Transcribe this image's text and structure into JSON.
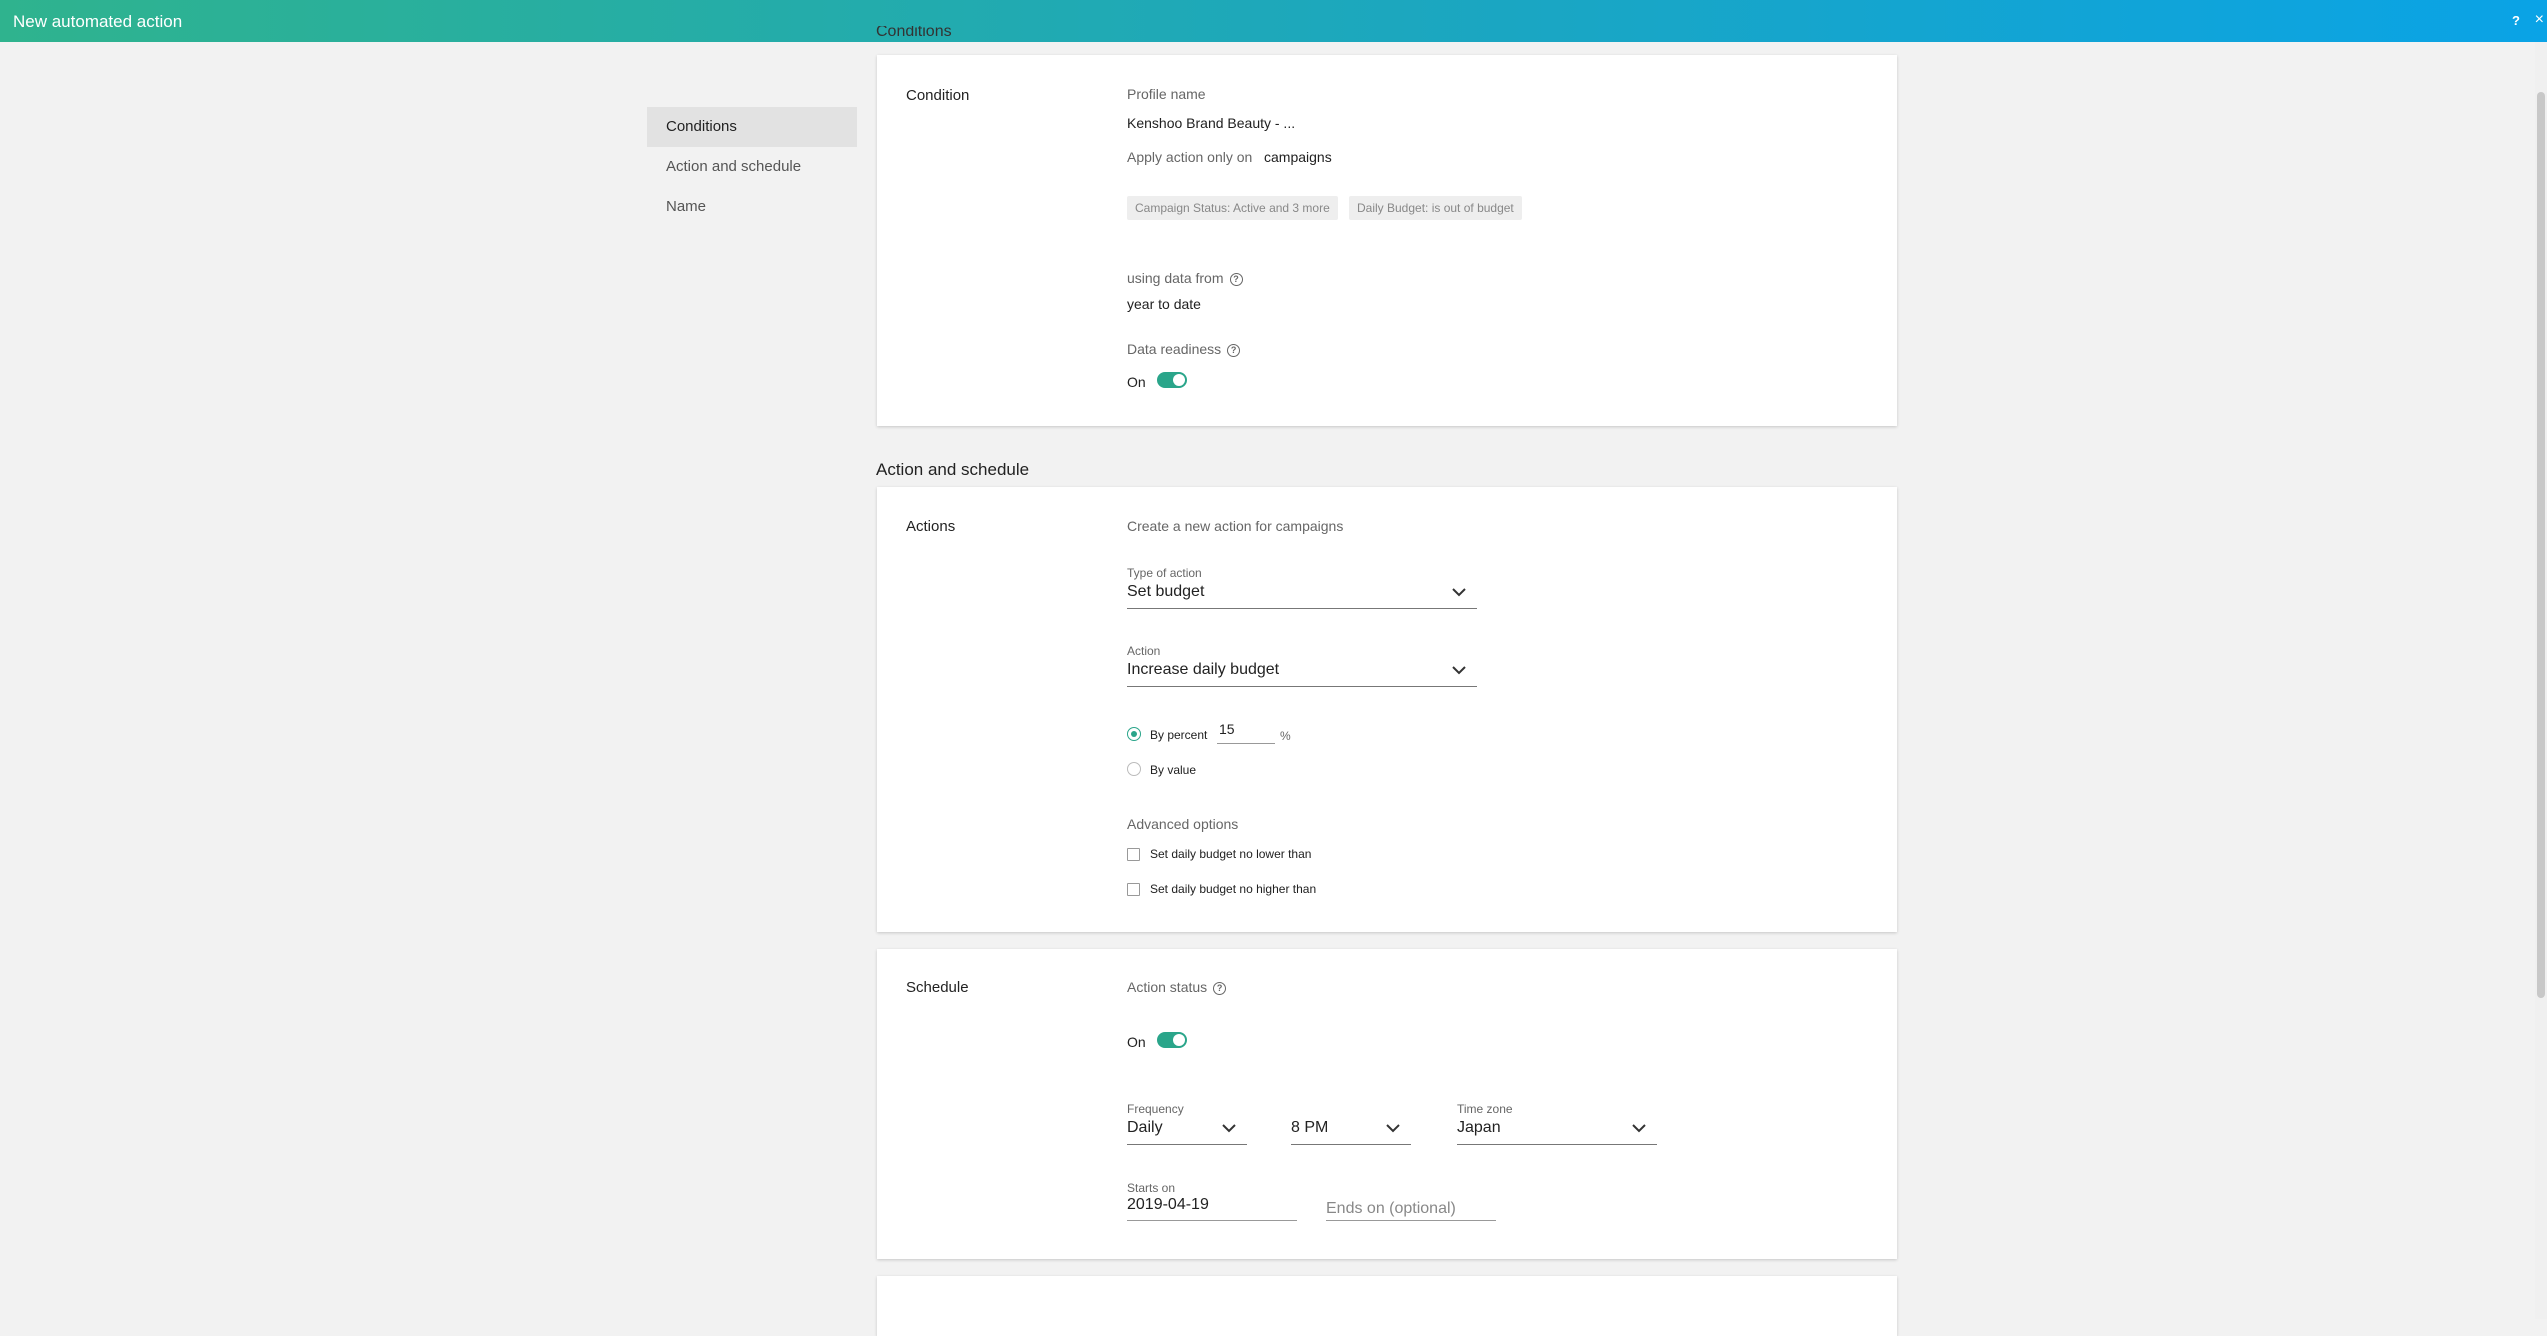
{
  "header": {
    "title": "New automated action",
    "help_label": "?",
    "close_label": "×"
  },
  "nav": {
    "items": [
      {
        "label": "Conditions"
      },
      {
        "label": "Action and schedule"
      },
      {
        "label": "Name"
      }
    ]
  },
  "conditions_section": {
    "heading_cut": "Conditions",
    "card_label": "Condition",
    "profile_name_label": "Profile name",
    "profile_name_value": "Kenshoo Brand Beauty - ...",
    "apply_label": "Apply action only on",
    "apply_value": "campaigns",
    "filters": [
      "Campaign Status: Active and 3 more",
      "Daily Budget: is out of budget"
    ],
    "data_from_label": "using data from",
    "data_from_value": "year to date",
    "data_readiness_label": "Data readiness",
    "data_readiness_toggle": "On"
  },
  "action_schedule_section": {
    "heading": "Action and schedule",
    "actions": {
      "card_label": "Actions",
      "intro": "Create a new action for campaigns",
      "type_label": "Type of action",
      "type_value": "Set budget",
      "action_label": "Action",
      "action_value": "Increase daily budget",
      "by_percent_label": "By percent",
      "percent_value": "15",
      "percent_unit": "%",
      "by_value_label": "By value",
      "advanced_label": "Advanced options",
      "no_lower_label": "Set daily budget no lower than",
      "no_higher_label": "Set daily budget no higher than"
    },
    "schedule": {
      "card_label": "Schedule",
      "status_label": "Action status",
      "status_toggle": "On",
      "frequency_label": "Frequency",
      "frequency_value": "Daily",
      "time_value": "8 PM",
      "timezone_label": "Time zone",
      "timezone_value": "Japan",
      "starts_label": "Starts on",
      "starts_value": "2019-04-19",
      "ends_placeholder": "Ends on (optional)"
    }
  },
  "colors": {
    "accent": "#2aa58a",
    "header_start": "#2fb38e",
    "header_end": "#0aa3e6"
  }
}
